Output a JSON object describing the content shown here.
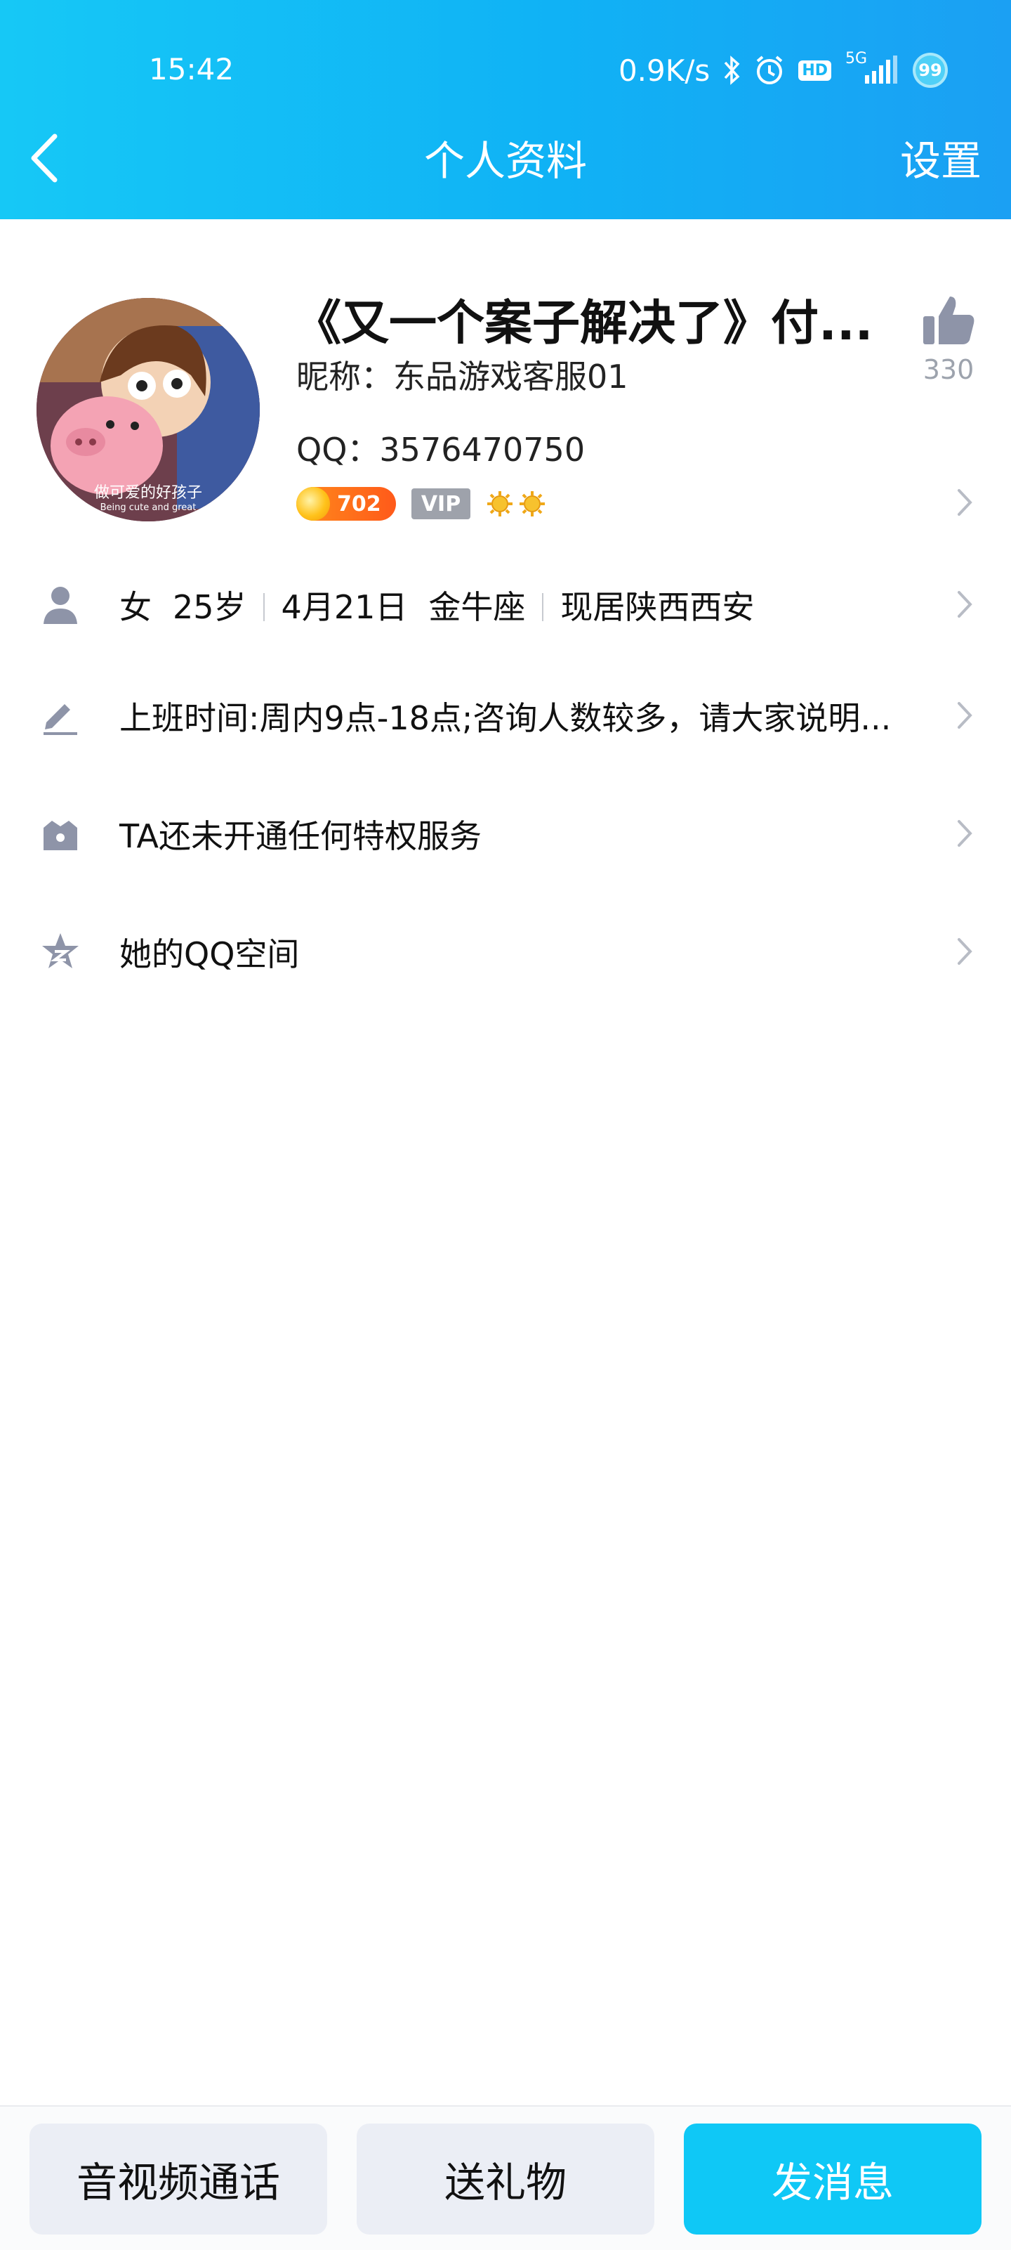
{
  "status_bar": {
    "time": "15:42",
    "net_speed": "0.9K/s",
    "network": "5G",
    "hd": "HD",
    "battery": "99"
  },
  "nav": {
    "title": "个人资料",
    "settings": "设置"
  },
  "profile": {
    "display_name": "《又一个案子解决了》付...",
    "nickname": "昵称：东品游戏客服01",
    "qq": "QQ：3576470750",
    "coin_level": "702",
    "vip_label": "VIP",
    "likes": "330",
    "avatar_caption": "做可爱的好孩子",
    "avatar_caption_en": "Being cute and great"
  },
  "info": {
    "gender": "女",
    "age": "25岁",
    "birthday": "4月21日",
    "zodiac": "金牛座",
    "location": "现居陕西西安",
    "signature": "上班时间:周内9点-18点;咨询人数较多，请大家说明...",
    "privilege": "TA还未开通任何特权服务",
    "qzone": "她的QQ空间"
  },
  "actions": {
    "call": "音视频通话",
    "gift": "送礼物",
    "message": "发消息"
  },
  "colors": {
    "header_start": "#16c8f6",
    "header_end": "#1ba0f3",
    "primary_button": "#0fc8f6",
    "icon_grey": "#8e94a8"
  }
}
